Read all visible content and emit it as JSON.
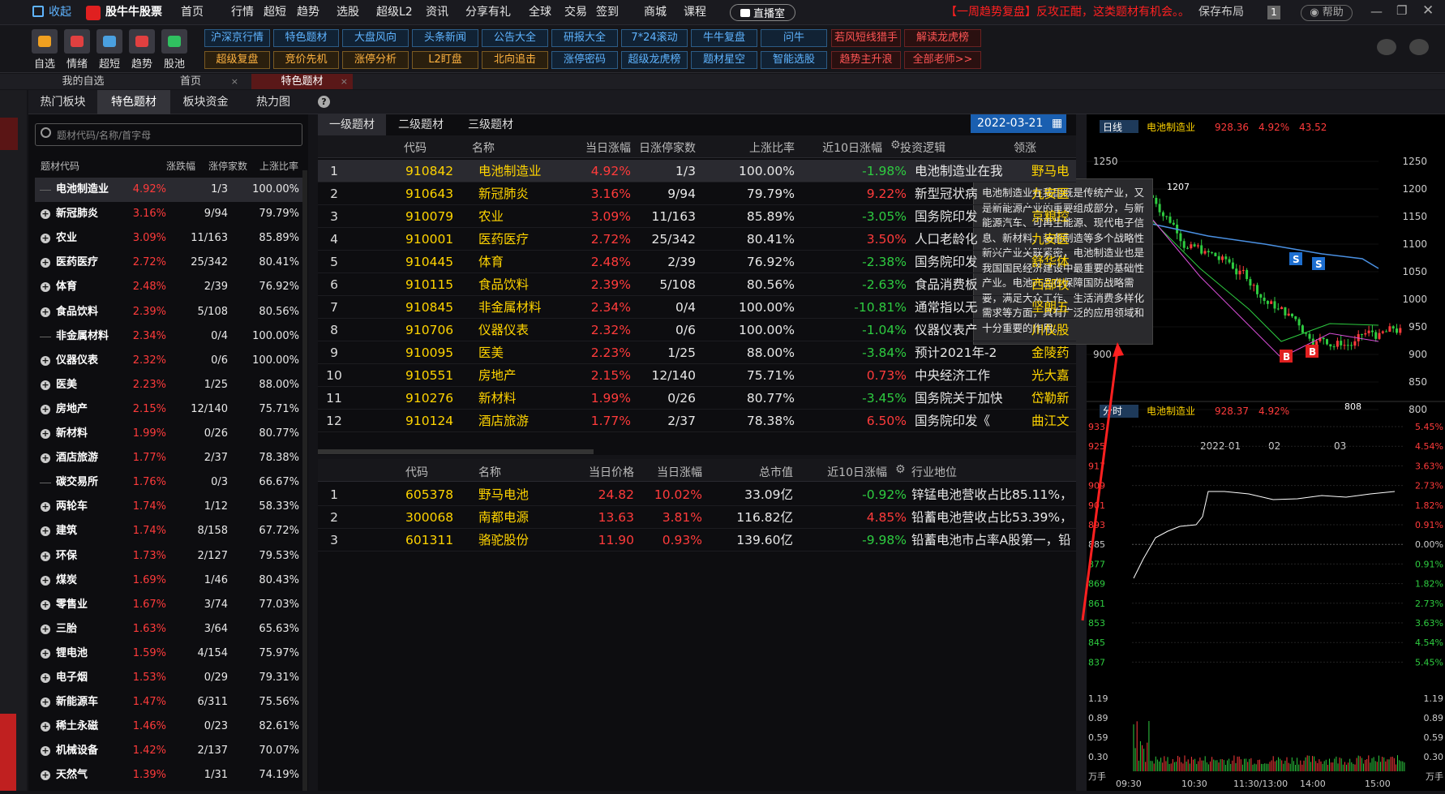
{
  "topbar": {
    "collapse": "收起",
    "brand": "股牛牛股票",
    "nav": [
      "首页",
      "行情",
      "超短",
      "趋势",
      "选股",
      "超级L2",
      "资讯",
      "分享有礼",
      "全球",
      "交易",
      "签到",
      "商城",
      "课程"
    ],
    "live": "直播室",
    "marquee": "【一周趋势复盘】反攻正酣，这类题材有机会。。",
    "save_layout": "保存布局",
    "badge": "1",
    "help": "帮助"
  },
  "toolbar": {
    "icons": [
      "自选",
      "情绪",
      "超短",
      "趋势",
      "股池"
    ],
    "row1": [
      "沪深京行情",
      "特色题材",
      "大盘风向",
      "头条新闻",
      "公告大全",
      "研报大全",
      "7*24滚动",
      "牛牛复盘",
      "问牛",
      "若风短线猎手",
      "解读龙虎榜"
    ],
    "row2": [
      "超级复盘",
      "竞价先机",
      "涨停分析",
      "L2盯盘",
      "北向追击",
      "涨停密码",
      "超级龙虎榜",
      "题材星空",
      "智能选股",
      "趋势主升浪",
      "全部老师>>"
    ]
  },
  "tabs": [
    "我的自选",
    "首页",
    "特色题材"
  ],
  "subtabs": [
    "热门板块",
    "特色题材",
    "板块资金",
    "热力图"
  ],
  "search": {
    "placeholder": "题材代码/名称/首字母"
  },
  "left": {
    "headers": [
      "题材代码",
      "涨跌幅",
      "涨停家数",
      "上涨比率"
    ],
    "rows": [
      [
        "电池制造业",
        "4.92%",
        "1/3",
        "100.00%"
      ],
      [
        "新冠肺炎",
        "3.16%",
        "9/94",
        "79.79%"
      ],
      [
        "农业",
        "3.09%",
        "11/163",
        "85.89%"
      ],
      [
        "医药医疗",
        "2.72%",
        "25/342",
        "80.41%"
      ],
      [
        "体育",
        "2.48%",
        "2/39",
        "76.92%"
      ],
      [
        "食品饮料",
        "2.39%",
        "5/108",
        "80.56%"
      ],
      [
        "非金属材料",
        "2.34%",
        "0/4",
        "100.00%"
      ],
      [
        "仪器仪表",
        "2.32%",
        "0/6",
        "100.00%"
      ],
      [
        "医美",
        "2.23%",
        "1/25",
        "88.00%"
      ],
      [
        "房地产",
        "2.15%",
        "12/140",
        "75.71%"
      ],
      [
        "新材料",
        "1.99%",
        "0/26",
        "80.77%"
      ],
      [
        "酒店旅游",
        "1.77%",
        "2/37",
        "78.38%"
      ],
      [
        "碳交易所",
        "1.76%",
        "0/3",
        "66.67%"
      ],
      [
        "两轮车",
        "1.74%",
        "1/12",
        "58.33%"
      ],
      [
        "建筑",
        "1.74%",
        "8/158",
        "67.72%"
      ],
      [
        "环保",
        "1.73%",
        "2/127",
        "79.53%"
      ],
      [
        "煤炭",
        "1.69%",
        "1/46",
        "80.43%"
      ],
      [
        "零售业",
        "1.67%",
        "3/74",
        "77.03%"
      ],
      [
        "三胎",
        "1.63%",
        "3/64",
        "65.63%"
      ],
      [
        "锂电池",
        "1.59%",
        "4/154",
        "75.97%"
      ],
      [
        "电子烟",
        "1.53%",
        "0/29",
        "79.31%"
      ],
      [
        "新能源车",
        "1.47%",
        "6/311",
        "75.56%"
      ],
      [
        "稀土永磁",
        "1.46%",
        "0/23",
        "82.61%"
      ],
      [
        "机械设备",
        "1.42%",
        "2/137",
        "70.07%"
      ],
      [
        "天然气",
        "1.39%",
        "1/31",
        "74.19%"
      ]
    ]
  },
  "levels": [
    "一级题材",
    "二级题材",
    "三级题材"
  ],
  "date": "2022-03-21",
  "top_table": {
    "headers": [
      "代码",
      "名称",
      "当日涨幅",
      "日涨停家数",
      "上涨比率",
      "近10日涨幅",
      "投资逻辑",
      "领涨"
    ],
    "rows": [
      [
        "1",
        "910842",
        "电池制造业",
        "4.92%",
        "1/3",
        "100.00%",
        "-1.98%",
        "电池制造业在我",
        "野马电"
      ],
      [
        "2",
        "910643",
        "新冠肺炎",
        "3.16%",
        "9/94",
        "79.79%",
        "9.22%",
        "新型冠状病",
        "九安医"
      ],
      [
        "3",
        "910079",
        "农业",
        "3.09%",
        "11/163",
        "85.89%",
        "-3.05%",
        "国务院印发",
        "京粮控"
      ],
      [
        "4",
        "910001",
        "医药医疗",
        "2.72%",
        "25/342",
        "80.41%",
        "3.50%",
        "人口老龄化",
        "九安医"
      ],
      [
        "5",
        "910445",
        "体育",
        "2.48%",
        "2/39",
        "76.92%",
        "-2.38%",
        "国务院印发",
        "舒华体"
      ],
      [
        "6",
        "910115",
        "食品饮料",
        "2.39%",
        "5/108",
        "80.56%",
        "-2.63%",
        "食品消费板",
        "西部牧"
      ],
      [
        "7",
        "910845",
        "非金属材料",
        "2.34%",
        "0/4",
        "100.00%",
        "-10.81%",
        "通常指以无",
        "坚朗五"
      ],
      [
        "8",
        "910706",
        "仪器仪表",
        "2.32%",
        "0/6",
        "100.00%",
        "-1.04%",
        "仪器仪表产",
        "川仪股"
      ],
      [
        "9",
        "910095",
        "医美",
        "2.23%",
        "1/25",
        "88.00%",
        "-3.84%",
        "预计2021年-2",
        "金陵药"
      ],
      [
        "10",
        "910551",
        "房地产",
        "2.15%",
        "12/140",
        "75.71%",
        "0.73%",
        "中央经济工作",
        "光大嘉"
      ],
      [
        "11",
        "910276",
        "新材料",
        "1.99%",
        "0/26",
        "80.77%",
        "-3.45%",
        "国务院关于加快",
        "岱勒新"
      ],
      [
        "12",
        "910124",
        "酒店旅游",
        "1.77%",
        "2/37",
        "78.38%",
        "6.50%",
        "国务院印发《",
        "曲江文"
      ]
    ]
  },
  "bot_table": {
    "headers": [
      "代码",
      "名称",
      "当日价格",
      "当日涨幅",
      "总市值",
      "近10日涨幅",
      "行业地位"
    ],
    "rows": [
      [
        "1",
        "605378",
        "野马电池",
        "24.82",
        "10.02%",
        "33.09亿",
        "-0.92%",
        "锌锰电池营收占比85.11%，"
      ],
      [
        "2",
        "300068",
        "南都电源",
        "13.63",
        "3.81%",
        "116.82亿",
        "4.85%",
        "铅蓄电池营收占比53.39%，"
      ],
      [
        "3",
        "601311",
        "骆驼股份",
        "11.90",
        "0.93%",
        "139.60亿",
        "-9.98%",
        "铅蓄电池市占率A股第一，铅"
      ]
    ]
  },
  "tooltip": "电池制造业在我国既是传统产业，又是新能源产业的重要组成部分，与新能源汽车、可再生能源、现代电子信息、新材料、装备制造等多个战略性新兴产业关联紧密，电池制造业也是我国国民经济建设中最重要的基础性产业。电池产品在保障国防战略需要，满足大众工作、生活消费多样化需求等方面，具有广泛的应用领域和十分重要的作用。",
  "kline": {
    "period": "日线",
    "name": "电池制造业",
    "price": "928.36",
    "pct": "4.92%",
    "chg": "43.52",
    "yticks": [
      "1250",
      "1200",
      "1150",
      "1100",
      "1050",
      "1000",
      "950",
      "900",
      "850",
      "800"
    ],
    "xticks": [
      "2022-01",
      "02",
      "03"
    ],
    "max_label": "1207",
    "min_label": "808"
  },
  "minute": {
    "period": "分时",
    "name": "电池制造业",
    "price": "928.37",
    "pct": "4.92%",
    "left_ticks": [
      "933",
      "925",
      "917",
      "909",
      "901",
      "893",
      "885",
      "877",
      "869",
      "861",
      "853",
      "845",
      "837"
    ],
    "right_ticks": [
      "5.45%",
      "4.54%",
      "3.63%",
      "2.73%",
      "1.82%",
      "0.91%",
      "0.00%",
      "0.91%",
      "1.82%",
      "2.73%",
      "3.63%",
      "4.54%",
      "5.45%"
    ],
    "vol_left": [
      "1.19",
      "0.89",
      "0.59",
      "0.30",
      "万手"
    ],
    "vol_right": [
      "1.19",
      "0.89",
      "0.59",
      "0.30",
      "万手"
    ],
    "times": [
      "09:30",
      "10:30",
      "11:30/13:00",
      "14:00",
      "15:00"
    ]
  },
  "colors": {
    "up": "#ff3b3b",
    "down": "#2ecc40",
    "code": "#ffd400",
    "accent": "#5fb4ff"
  }
}
